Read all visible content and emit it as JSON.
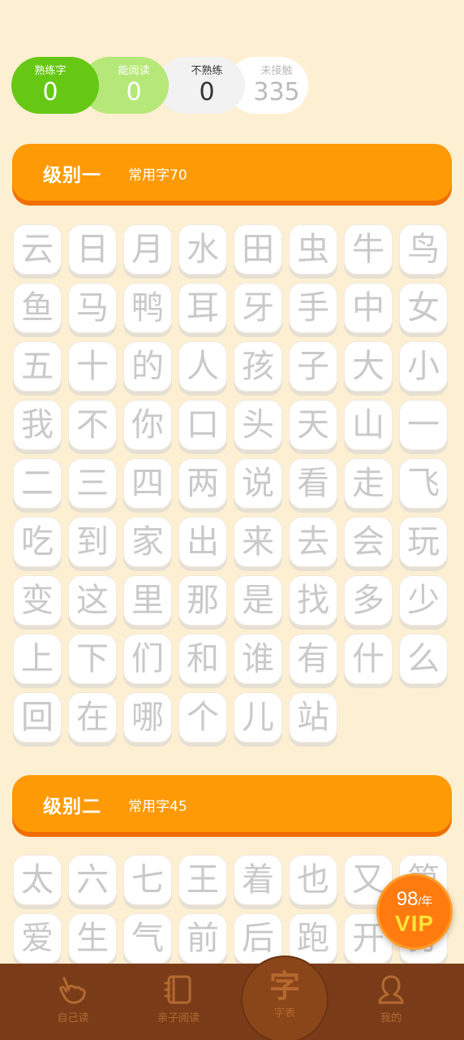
{
  "stats": [
    {
      "label": "熟练字",
      "value": "0"
    },
    {
      "label": "能阅读",
      "value": "0"
    },
    {
      "label": "不熟练",
      "value": "0"
    },
    {
      "label": "未接触",
      "value": "335"
    }
  ],
  "levels": [
    {
      "title": "级别一",
      "subtitle": "常用字70",
      "chars": [
        "云",
        "日",
        "月",
        "水",
        "田",
        "虫",
        "牛",
        "鸟",
        "鱼",
        "马",
        "鸭",
        "耳",
        "牙",
        "手",
        "中",
        "女",
        "五",
        "十",
        "的",
        "人",
        "孩",
        "子",
        "大",
        "小",
        "我",
        "不",
        "你",
        "口",
        "头",
        "天",
        "山",
        "一",
        "二",
        "三",
        "四",
        "两",
        "说",
        "看",
        "走",
        "飞",
        "吃",
        "到",
        "家",
        "出",
        "来",
        "去",
        "会",
        "玩",
        "变",
        "这",
        "里",
        "那",
        "是",
        "找",
        "多",
        "少",
        "上",
        "下",
        "们",
        "和",
        "谁",
        "有",
        "什",
        "么",
        "回",
        "在",
        "哪",
        "个",
        "儿",
        "站"
      ]
    },
    {
      "title": "级别二",
      "subtitle": "常用字45",
      "chars": [
        "太",
        "六",
        "七",
        "王",
        "着",
        "也",
        "又",
        "第",
        "爱",
        "生",
        "气",
        "前",
        "后",
        "跑",
        "开",
        "打"
      ]
    }
  ],
  "vip": {
    "price": "98",
    "unit": "/年",
    "tag": "VIP"
  },
  "tabs": [
    {
      "label": "自己读",
      "icon": "hand-point-icon"
    },
    {
      "label": "亲子阅读",
      "icon": "book-icon"
    },
    {
      "label": "字表",
      "glyph": "字",
      "icon": "character-icon"
    },
    {
      "label": "我的",
      "icon": "user-icon"
    }
  ],
  "colors": {
    "accent": "#fe9a05",
    "background": "#fdefd2",
    "tabbar": "#7a3c18",
    "mastered": "#66c814"
  }
}
